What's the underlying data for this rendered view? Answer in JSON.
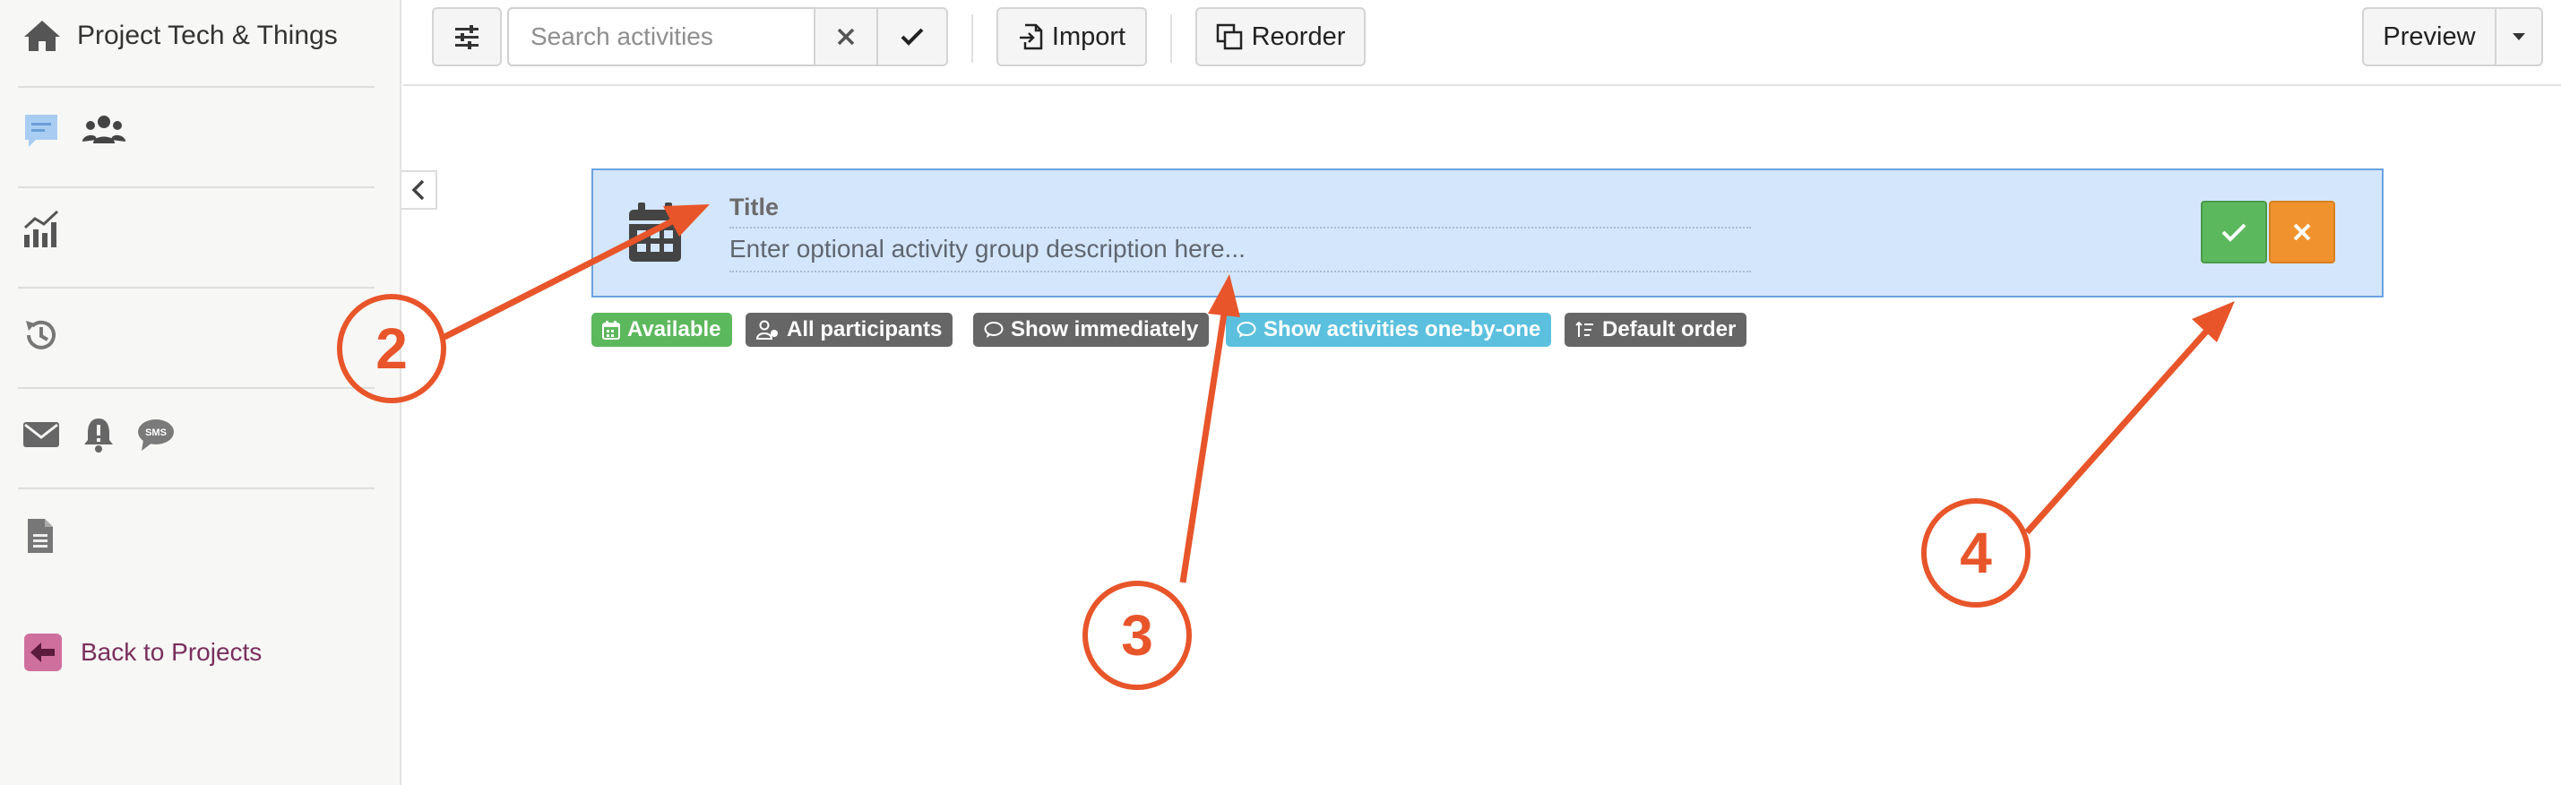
{
  "sidebar": {
    "project_title": "Project Tech & Things",
    "back_label": "Back to Projects",
    "icons": [
      "home-icon",
      "chat-icon",
      "participants-icon",
      "analytics-icon",
      "history-icon",
      "email-icon",
      "notification-bell-icon",
      "sms-icon",
      "document-icon",
      "back-arrow-icon"
    ]
  },
  "toolbar": {
    "search_placeholder": "Search activities",
    "import_label": "Import",
    "reorder_label": "Reorder",
    "preview_label": "Preview"
  },
  "group": {
    "title": "Title",
    "description_placeholder": "Enter optional activity group description here..."
  },
  "tags": [
    {
      "label": "Available",
      "color": "#5cb85c"
    },
    {
      "label": "All participants",
      "color": "#666666"
    },
    {
      "label": "Show immediately",
      "color": "#666666"
    },
    {
      "label": "Show activities one-by-one",
      "color": "#5bc0de"
    },
    {
      "label": "Default order",
      "color": "#666666"
    }
  ],
  "annotations": [
    "2",
    "3",
    "4"
  ],
  "colors": {
    "accent_blue": "#d4e6fb",
    "confirm_green": "#5cb85c",
    "cancel_orange": "#f0932e",
    "annotation_orange": "#e8552a",
    "back_link": "#7a2f5c"
  }
}
